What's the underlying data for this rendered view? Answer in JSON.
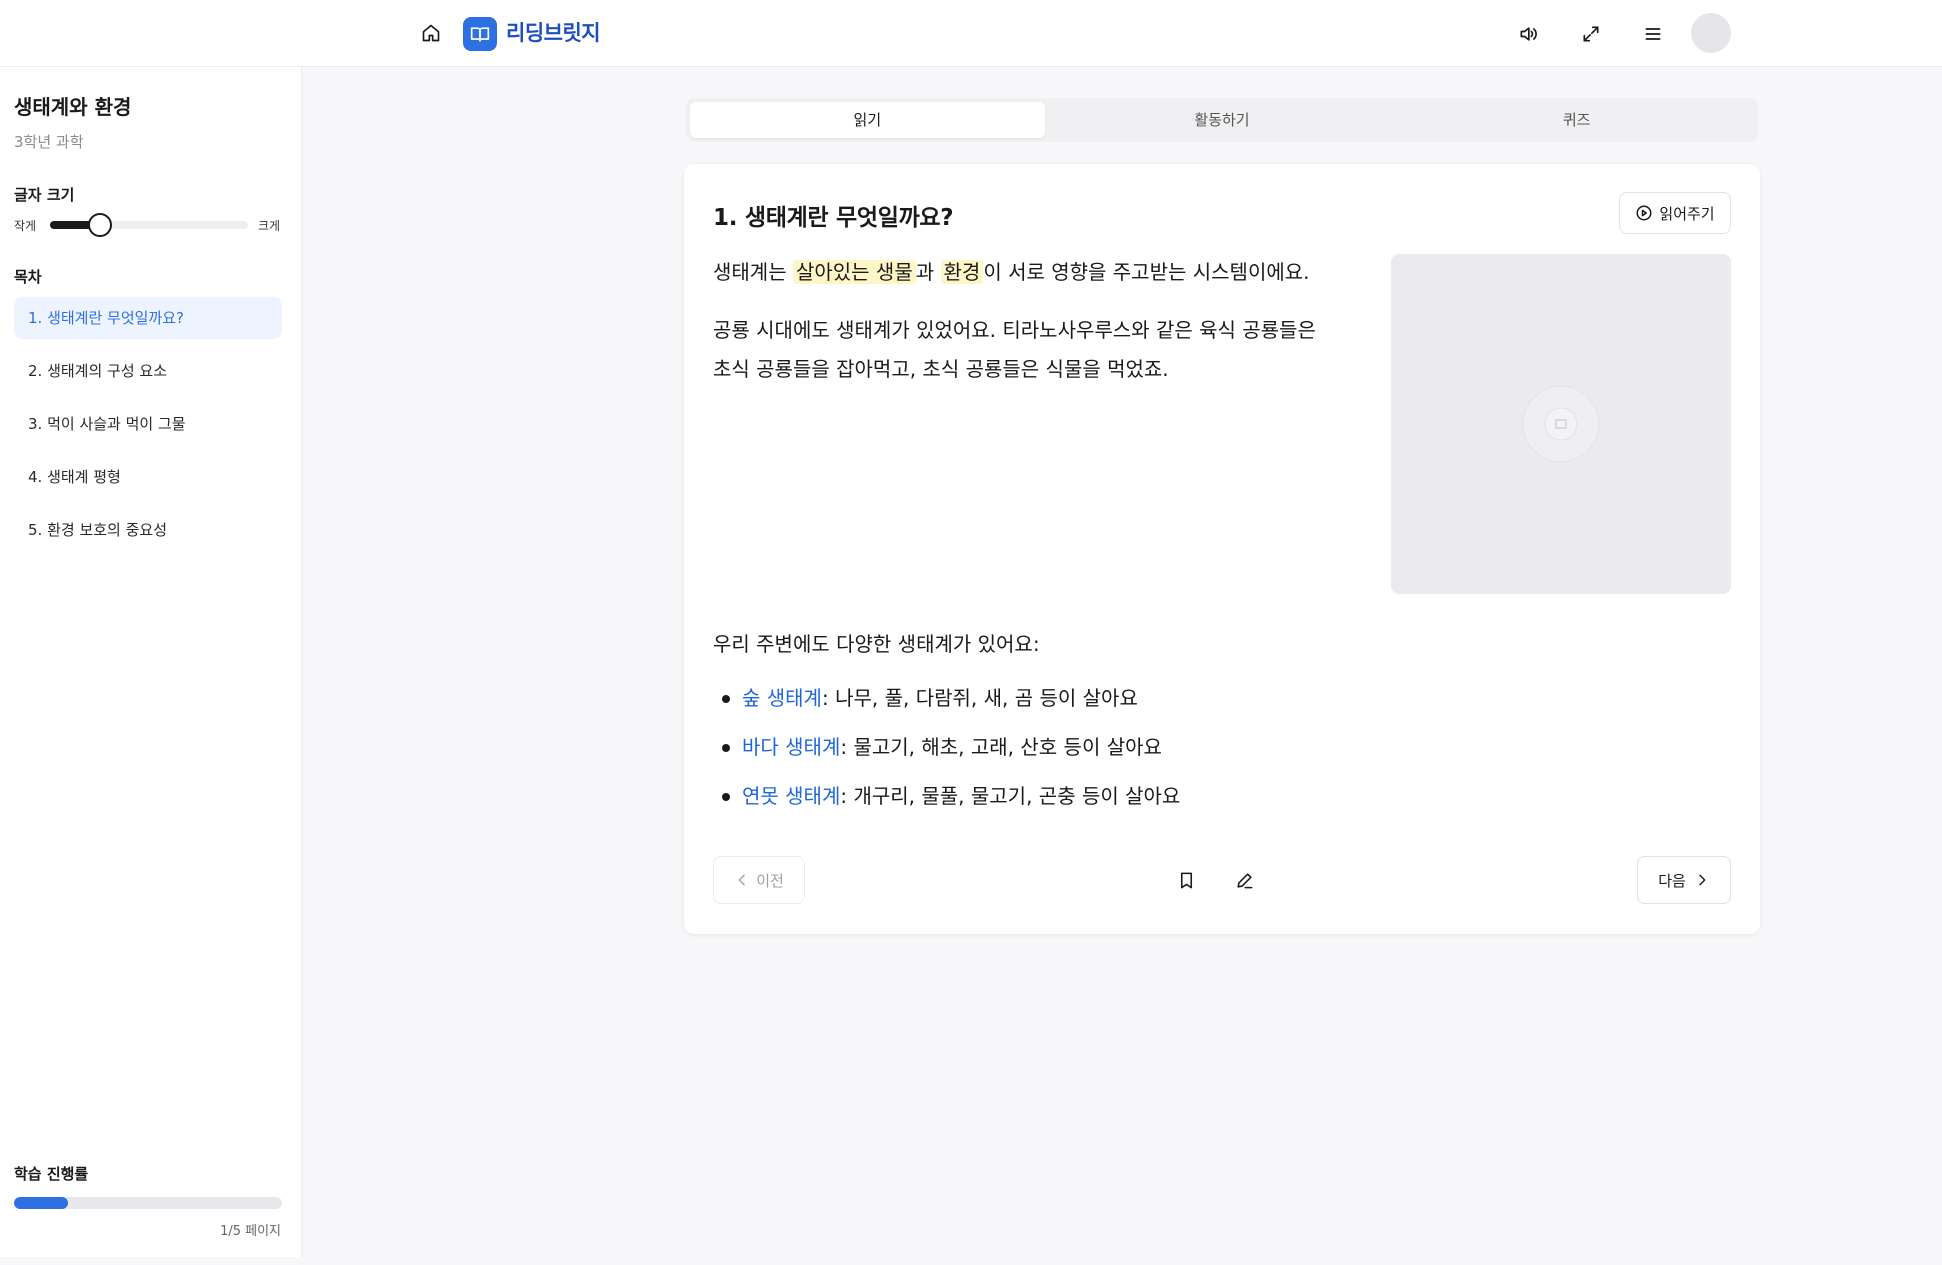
{
  "header": {
    "brand": "리딩브릿지",
    "icons": [
      "home-icon",
      "book-icon",
      "volume-icon",
      "fullscreen-icon",
      "menu-icon",
      "avatar"
    ]
  },
  "sidebar": {
    "title": "생태계와 환경",
    "subtitle": "3학년 과학",
    "font_size": {
      "label": "글자 크기",
      "small": "작게",
      "large": "크게",
      "value_fraction": 0.25
    },
    "toc_label": "목차",
    "toc": [
      {
        "label": "1. 생태계란 무엇일까요?",
        "active": true
      },
      {
        "label": "2. 생태계의 구성 요소",
        "active": false
      },
      {
        "label": "3. 먹이 사슬과 먹이 그물",
        "active": false
      },
      {
        "label": "4. 생태계 평형",
        "active": false
      },
      {
        "label": "5. 환경 보호의 중요성",
        "active": false
      }
    ],
    "progress": {
      "label": "학습 진행률",
      "text": "1/5 페이지",
      "fraction": 0.2
    }
  },
  "tabs": [
    {
      "label": "읽기",
      "active": true
    },
    {
      "label": "활동하기",
      "active": false
    },
    {
      "label": "퀴즈",
      "active": false
    }
  ],
  "content": {
    "title": "1. 생태계란 무엇일까요?",
    "read_aloud": "읽어주기",
    "p1": {
      "before": "생태계는 ",
      "hl1": "살아있는 생물",
      "mid": "과 ",
      "hl2": "환경",
      "after": "이 서로 영향을 주고받는 시스템이에요."
    },
    "p2_line1": "공룡 시대에도 생태계가 있었어요. 티라노사우루스와 같은 육식 공룡들은",
    "p2_line2": "초식 공룡들을 잡아먹고, 초식 공룡들은 식물을 먹었죠.",
    "p3": "우리 주변에도 다양한 생태계가 있어요:",
    "list": [
      {
        "term": "숲 생태계",
        "desc": ": 나무, 풀, 다람쥐, 새, 곰 등이 살아요"
      },
      {
        "term": "바다 생태계",
        "desc": ": 물고기, 해초, 고래, 산호 등이 살아요"
      },
      {
        "term": "연못 생태계",
        "desc": ": 개구리, 물풀, 물고기, 곤충 등이 살아요"
      }
    ],
    "prev": "이전",
    "next": "다음"
  },
  "colors": {
    "accent": "#2f6fe4",
    "highlight": "#fff6c8",
    "term": "#1f66d8"
  }
}
